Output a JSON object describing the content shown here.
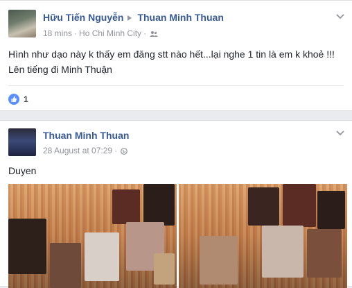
{
  "post1": {
    "author": "Hữu Tiến Nguyễn",
    "target": "Thuan Minh Thuan",
    "time": "18 mins",
    "location": "Ho Chi Minh City",
    "text_line1": "Hình như dạo này k thấy em đăng stt nào hết...lại nghe 1 tin là em k khoẻ !!!",
    "text_line2": "Lên tiếng đi Minh Thuận",
    "like_count": "1"
  },
  "post2": {
    "author": "Thuan Minh Thuan",
    "time": "28 August at 07:29",
    "text": "Duyen"
  },
  "colors": {
    "link": "#365899",
    "meta": "#90949c",
    "like": "#5890ff",
    "background": "#e9ebee"
  }
}
